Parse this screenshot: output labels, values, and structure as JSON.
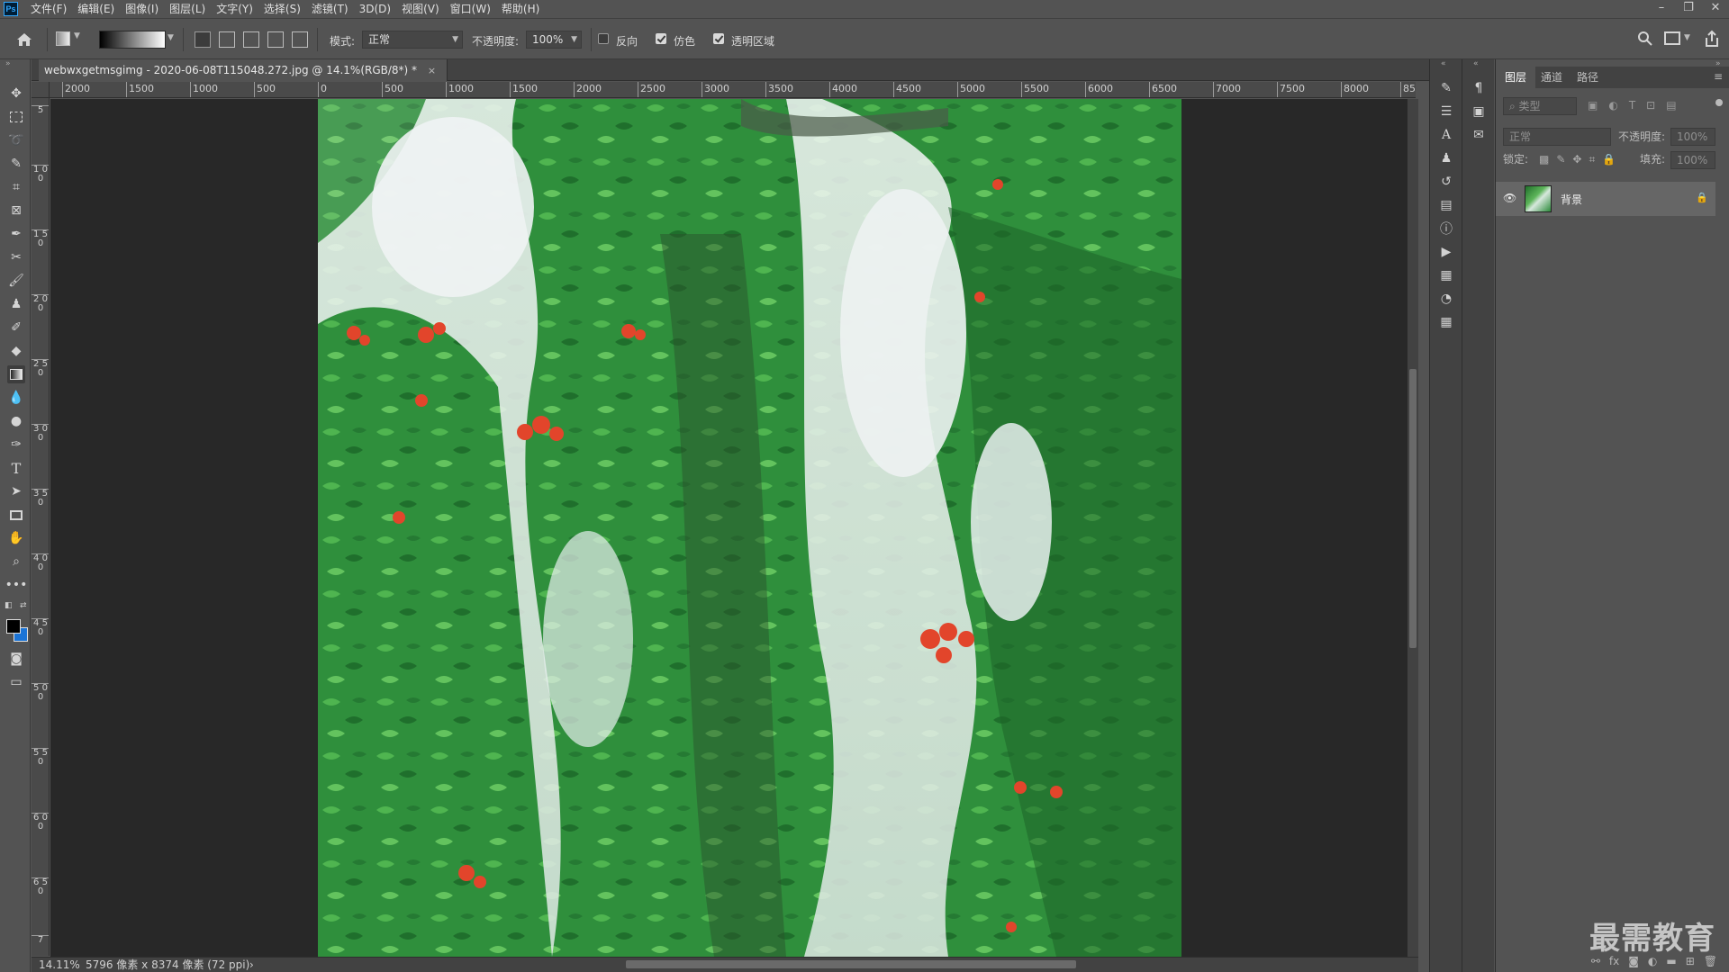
{
  "app": {
    "logo": "Ps"
  },
  "menu": [
    "文件(F)",
    "编辑(E)",
    "图像(I)",
    "图层(L)",
    "文字(Y)",
    "选择(S)",
    "滤镜(T)",
    "3D(D)",
    "视图(V)",
    "窗口(W)",
    "帮助(H)"
  ],
  "window_controls": {
    "minimize": "–",
    "restore": "❐",
    "close": "✕"
  },
  "options": {
    "mode_label": "模式:",
    "mode_value": "正常",
    "opacity_label": "不透明度:",
    "opacity_value": "100%",
    "reverse_label": "反向",
    "reverse_checked": false,
    "dither_label": "仿色",
    "dither_checked": true,
    "transparency_label": "透明区域",
    "transparency_checked": true
  },
  "document": {
    "tab_title": "webwxgetmsgimg - 2020-06-08T115048.272.jpg @ 14.1%(RGB/8*) *",
    "close_glyph": "×"
  },
  "ruler_top": [
    "2000",
    "1500",
    "1000",
    "500",
    "0",
    "500",
    "1000",
    "1500",
    "2000",
    "2500",
    "3000",
    "3500",
    "4000",
    "4500",
    "5000",
    "5500",
    "6000",
    "6500",
    "7000",
    "7500",
    "8000",
    "85"
  ],
  "ruler_left": [
    "5",
    "1 0 0",
    "1 5 0",
    "2 0 0",
    "2 5 0",
    "3 0 0",
    "3 5 0",
    "4 0 0",
    "4 5 0",
    "5 0 0",
    "5 5 0",
    "6 0 0",
    "6 5 0",
    "7"
  ],
  "status": {
    "zoom": "14.11%",
    "info": "5796 像素 x 8374 像素 (72 ppi)",
    "arrow": "›"
  },
  "layers_panel": {
    "tabs": [
      "图层",
      "通道",
      "路径"
    ],
    "active_tab": "图层",
    "search_placeholder": "类型",
    "blend_mode": "正常",
    "opacity_label": "不透明度:",
    "opacity_value": "100%",
    "lock_label": "锁定:",
    "fill_label": "填充:",
    "fill_value": "100%",
    "layers": [
      {
        "name": "背景",
        "visible": true,
        "locked": true
      }
    ]
  },
  "footer_icons": [
    "link-icon",
    "fx-icon",
    "mask-icon",
    "adjustment-icon",
    "folder-icon",
    "new-layer-icon",
    "trash-icon"
  ],
  "footer_fx": "fx",
  "watermark": "最需教育",
  "colors": {
    "foreground": "#000000",
    "background": "#1b74d6",
    "panel_bg": "#535353",
    "canvas_bg": "#282828"
  }
}
